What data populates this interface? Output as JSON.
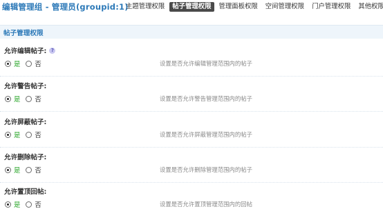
{
  "header": {
    "title": "编辑管理组 - 管理员(groupid:1)",
    "tabs": [
      {
        "label": "主题管理权限",
        "active": false
      },
      {
        "label": "帖子管理权限",
        "active": true
      },
      {
        "label": "管理面板权限",
        "active": false
      },
      {
        "label": "空间管理权限",
        "active": false
      },
      {
        "label": "门户管理权限",
        "active": false
      },
      {
        "label": "其他权限",
        "active": false
      }
    ]
  },
  "section": {
    "title": "帖子管理权限"
  },
  "settings": [
    {
      "label": "允许编辑帖子:",
      "has_help": true,
      "yes": "是",
      "no": "否",
      "selected": "yes",
      "description": "设置是否允许编辑管理范围内的帖子"
    },
    {
      "label": "允许警告帖子:",
      "has_help": false,
      "yes": "是",
      "no": "否",
      "selected": "yes",
      "description": "设置是否允许警告管理范围内的帖子"
    },
    {
      "label": "允许屏蔽帖子:",
      "has_help": false,
      "yes": "是",
      "no": "否",
      "selected": "yes",
      "description": "设置是否允许屏蔽管理范围内的帖子"
    },
    {
      "label": "允许删除帖子:",
      "has_help": false,
      "yes": "是",
      "no": "否",
      "selected": "yes",
      "description": "设置是否允许删除管理范围内的帖子"
    },
    {
      "label": "允许置顶回帖:",
      "has_help": false,
      "yes": "是",
      "no": "否",
      "selected": "yes",
      "description": "设置是否允许置顶管理范围内的回帖"
    }
  ],
  "colors": {
    "accent": "#2c79b8",
    "active_tab_bg": "#4a4a4a",
    "section_bg": "#eef5fb",
    "yes_green": "#2aa62a",
    "description_gray": "#8a8a8a"
  },
  "icons": {
    "help": "question-bubble-icon"
  }
}
